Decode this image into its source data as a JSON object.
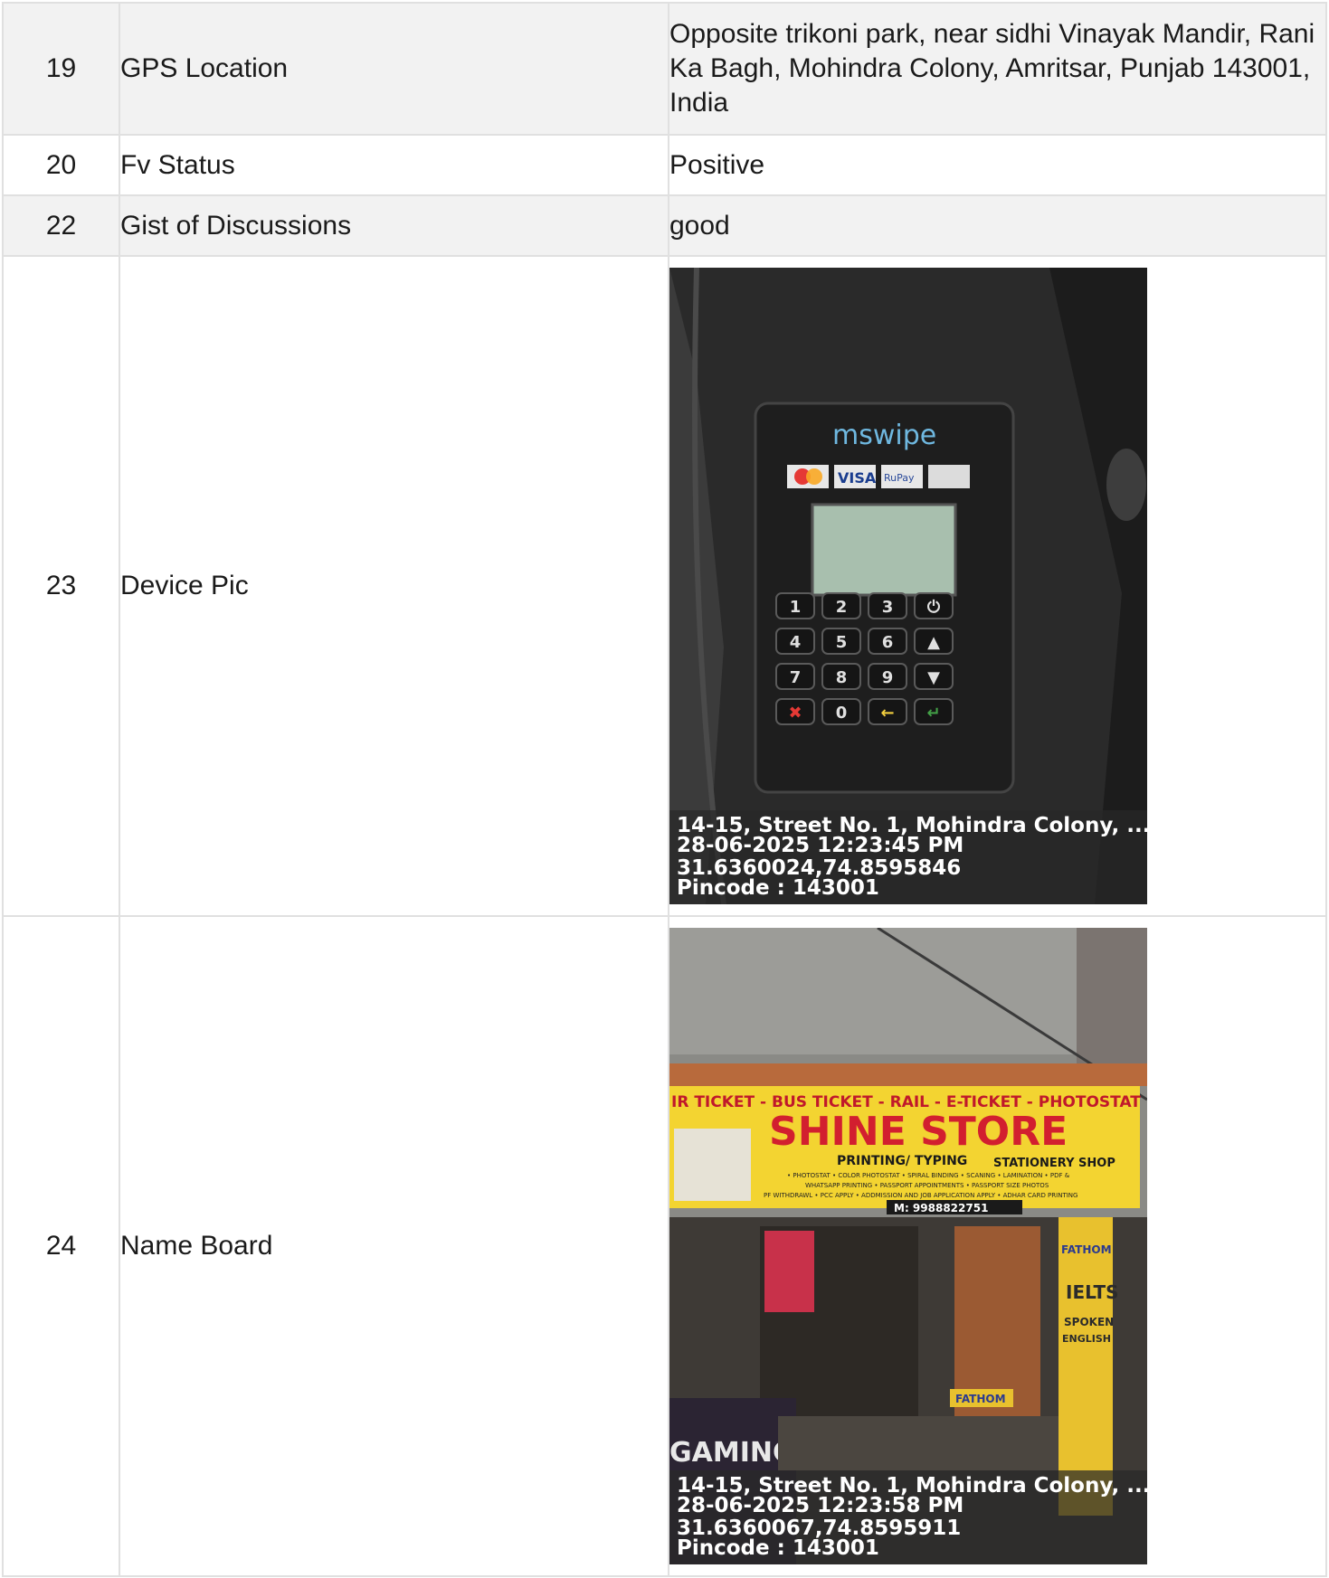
{
  "rows": [
    {
      "num": "19",
      "label": "GPS Location",
      "value": "Opposite trikoni park, near sidhi Vinayak Mandir, Rani Ka Bagh, Mohindra Colony, Amritsar, Punjab 143001, India"
    },
    {
      "num": "20",
      "label": "Fv Status",
      "value": "Positive"
    },
    {
      "num": "22",
      "label": "Gist of Discussions",
      "value": "good"
    },
    {
      "num": "23",
      "label": "Device Pic"
    },
    {
      "num": "24",
      "label": "Name Board"
    }
  ],
  "device_photo": {
    "brand": "mswipe",
    "cards": [
      "VISA",
      "RuPay"
    ],
    "keys": [
      "1",
      "2",
      "3",
      "⏻",
      "4",
      "5",
      "6",
      "▲",
      "7",
      "8",
      "9",
      "▼",
      "✖",
      "0",
      "←",
      "↵"
    ],
    "stamp": {
      "address": "14-15, Street No. 1, Mohindra Colony, ...",
      "datetime": "28-06-2025 12:23:45 PM",
      "coords": "31.6360024,74.8595846",
      "pincode": "Pincode : 143001"
    }
  },
  "board_photo": {
    "top_strip": "IR TICKET - BUS TICKET - RAIL - E-TICKET - PHOTOSTAT",
    "shop_name": "SHINE STORE",
    "sub_left": "PRINTING/ TYPING",
    "sub_right": "STATIONERY SHOP",
    "services_1": "• PHOTOSTAT • COLOR PHOTOSTAT • SPIRAL BINDING • SCANING • LAMINATION • PDF &",
    "services_2": "WHATSAPP PRINTING • PASSPORT APPOINTMENTS • PASSPORT SIZE PHOTOS",
    "services_3": "PF WITHDRAWL • PCC APPLY • ADDMISSION AND JOB APPLICATION APPLY • ADHAR CARD PRINTING",
    "mobile": "M: 9988822751",
    "side_sign": [
      "FATHOM",
      "IELTS",
      "SPOKEN",
      "ENGLISH"
    ],
    "step_sign": "FATHOM",
    "gaming": "GAMING",
    "stamp": {
      "address": "14-15, Street No. 1, Mohindra Colony, ...",
      "datetime": "28-06-2025 12:23:58 PM",
      "coords": "31.6360067,74.8595911",
      "pincode": "Pincode : 143001"
    }
  }
}
